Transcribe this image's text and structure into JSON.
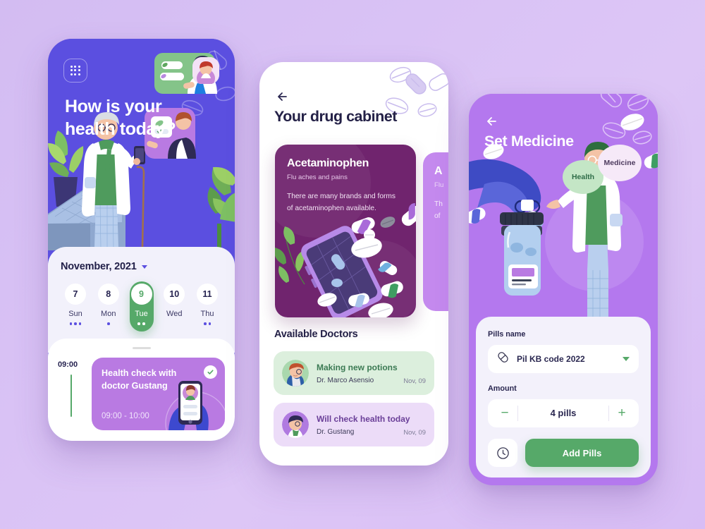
{
  "theme": {
    "background_gradient_from": "#d3bcf2",
    "background_gradient_to": "#d8bdf5",
    "accent_indigo": "#5b4fe0",
    "accent_green": "#56a969",
    "accent_purple": "#b478ee",
    "card_plum": "#70246e",
    "card_lilac": "#c489ee",
    "text_dark": "#242147"
  },
  "screen1": {
    "name": "home-health-screen",
    "grid_icon": "grid-menu-icon",
    "avatar_icon": "user-avatar",
    "title": "How is your\nhealth today?",
    "title_line1": "How is your",
    "title_line2": "health today?",
    "calendar": {
      "month_label": "November, 2021",
      "dropdown_icon": "chevron-down-icon",
      "days": [
        {
          "num": "7",
          "label": "Sun",
          "dots": 3,
          "active": false
        },
        {
          "num": "8",
          "label": "Mon",
          "dots": 1,
          "active": false
        },
        {
          "num": "9",
          "label": "Tue",
          "dots": 2,
          "active": true
        },
        {
          "num": "10",
          "label": "Wed",
          "dots": 0,
          "active": false
        },
        {
          "num": "11",
          "label": "Thu",
          "dots": 2,
          "active": false
        }
      ]
    },
    "schedule": {
      "time_marker": "09:00",
      "event_title_line1": "Health check with",
      "event_title_line2": "doctor Gustang",
      "event_range": "09:00 - 10:00",
      "status_icon": "check-circle-icon"
    }
  },
  "screen2": {
    "name": "drug-cabinet-screen",
    "back_icon": "arrow-left-icon",
    "title": "Your drug cabinet",
    "drug_card": {
      "name": "Acetaminophen",
      "subtitle": "Flu aches and pains",
      "description_line1": "There are many brands and forms",
      "description_line2": "of acetaminophen available."
    },
    "drug_card_next": {
      "name": "A",
      "subtitle": "Flu",
      "description_line1": "Th",
      "description_line2": "of"
    },
    "section_title": "Available Doctors",
    "doctors": [
      {
        "title": "Making new potions",
        "name": "Dr. Marco Asensio",
        "date": "Nov, 09",
        "avatar": "doctor-avatar-marco"
      },
      {
        "title": "Will check health today",
        "name": "Dr. Gustang",
        "date": "Nov, 09",
        "avatar": "doctor-avatar-gustang"
      }
    ]
  },
  "screen3": {
    "name": "set-medicine-screen",
    "back_icon": "arrow-left-icon",
    "title": "Set Medicine",
    "bubbles": [
      {
        "label": "Health",
        "color": "#c4e6c6"
      },
      {
        "label": "Medicine",
        "color": "#f6e9f8"
      }
    ],
    "form": {
      "pills_name_label": "Pills name",
      "pills_name_value": "Pil KB code 2022",
      "pills_name_icon": "capsule-icon",
      "pills_name_dropdown_icon": "chevron-down-icon",
      "amount_label": "Amount",
      "amount_value": "4 pills",
      "decrement_label": "−",
      "increment_label": "+",
      "clock_icon": "clock-icon",
      "submit_label": "Add Pills"
    }
  }
}
